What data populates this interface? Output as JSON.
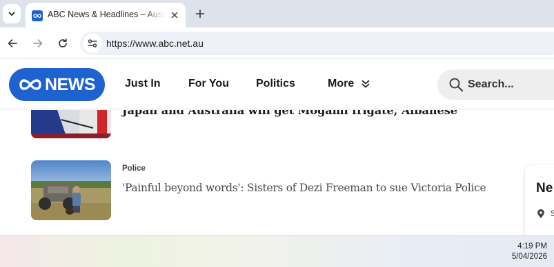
{
  "browser": {
    "tab": {
      "title": "ABC News & Headlines – Australian and World News",
      "favicon": "abc-logo-icon"
    },
    "url": "https://www.abc.net.au",
    "icons": {
      "tab_search": "chevron-down-icon",
      "close_tab": "close-icon",
      "new_tab": "plus-icon",
      "back": "back-arrow-icon",
      "forward": "forward-arrow-icon",
      "reload": "reload-icon",
      "site_info": "site-info-icon"
    }
  },
  "site": {
    "logo_text": "NEWS",
    "nav": [
      "Just In",
      "For You",
      "Politics",
      "More"
    ],
    "search_placeholder": "Search...",
    "brand_color": "#1e62d0"
  },
  "articles": [
    {
      "headline": "Japan and Australia will get Mogami frigate, Albanese"
    },
    {
      "topic": "Police",
      "headline": "'Painful beyond words': Sisters of Dezi Freeman to sue Victoria Police"
    }
  ],
  "side_card": {
    "title": "Ne",
    "location": "S"
  },
  "taskbar": {
    "time": "4:19 PM",
    "date": "5/04/2026"
  }
}
